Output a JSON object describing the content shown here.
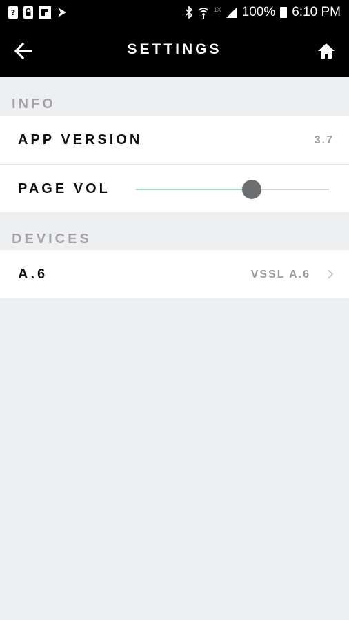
{
  "status_bar": {
    "battery": "100%",
    "time": "6:10 PM",
    "network_type": "1X"
  },
  "header": {
    "title": "SETTINGS",
    "back_icon": "arrow-left-icon",
    "home_icon": "home-icon"
  },
  "info": {
    "section_title": "INFO",
    "app_version_label": "APP VERSION",
    "app_version_value": "3.7",
    "page_vol_label": "PAGE VOL",
    "page_vol_level": 0.6
  },
  "devices": {
    "section_title": "DEVICES",
    "items": [
      {
        "label": "A.6",
        "value": "VSSL A.6"
      }
    ]
  },
  "colors": {
    "header_bg": "#000000",
    "page_bg": "#eeeff0",
    "slider_fill": "#9ed8cf",
    "slider_thumb": "#6d6e70"
  }
}
